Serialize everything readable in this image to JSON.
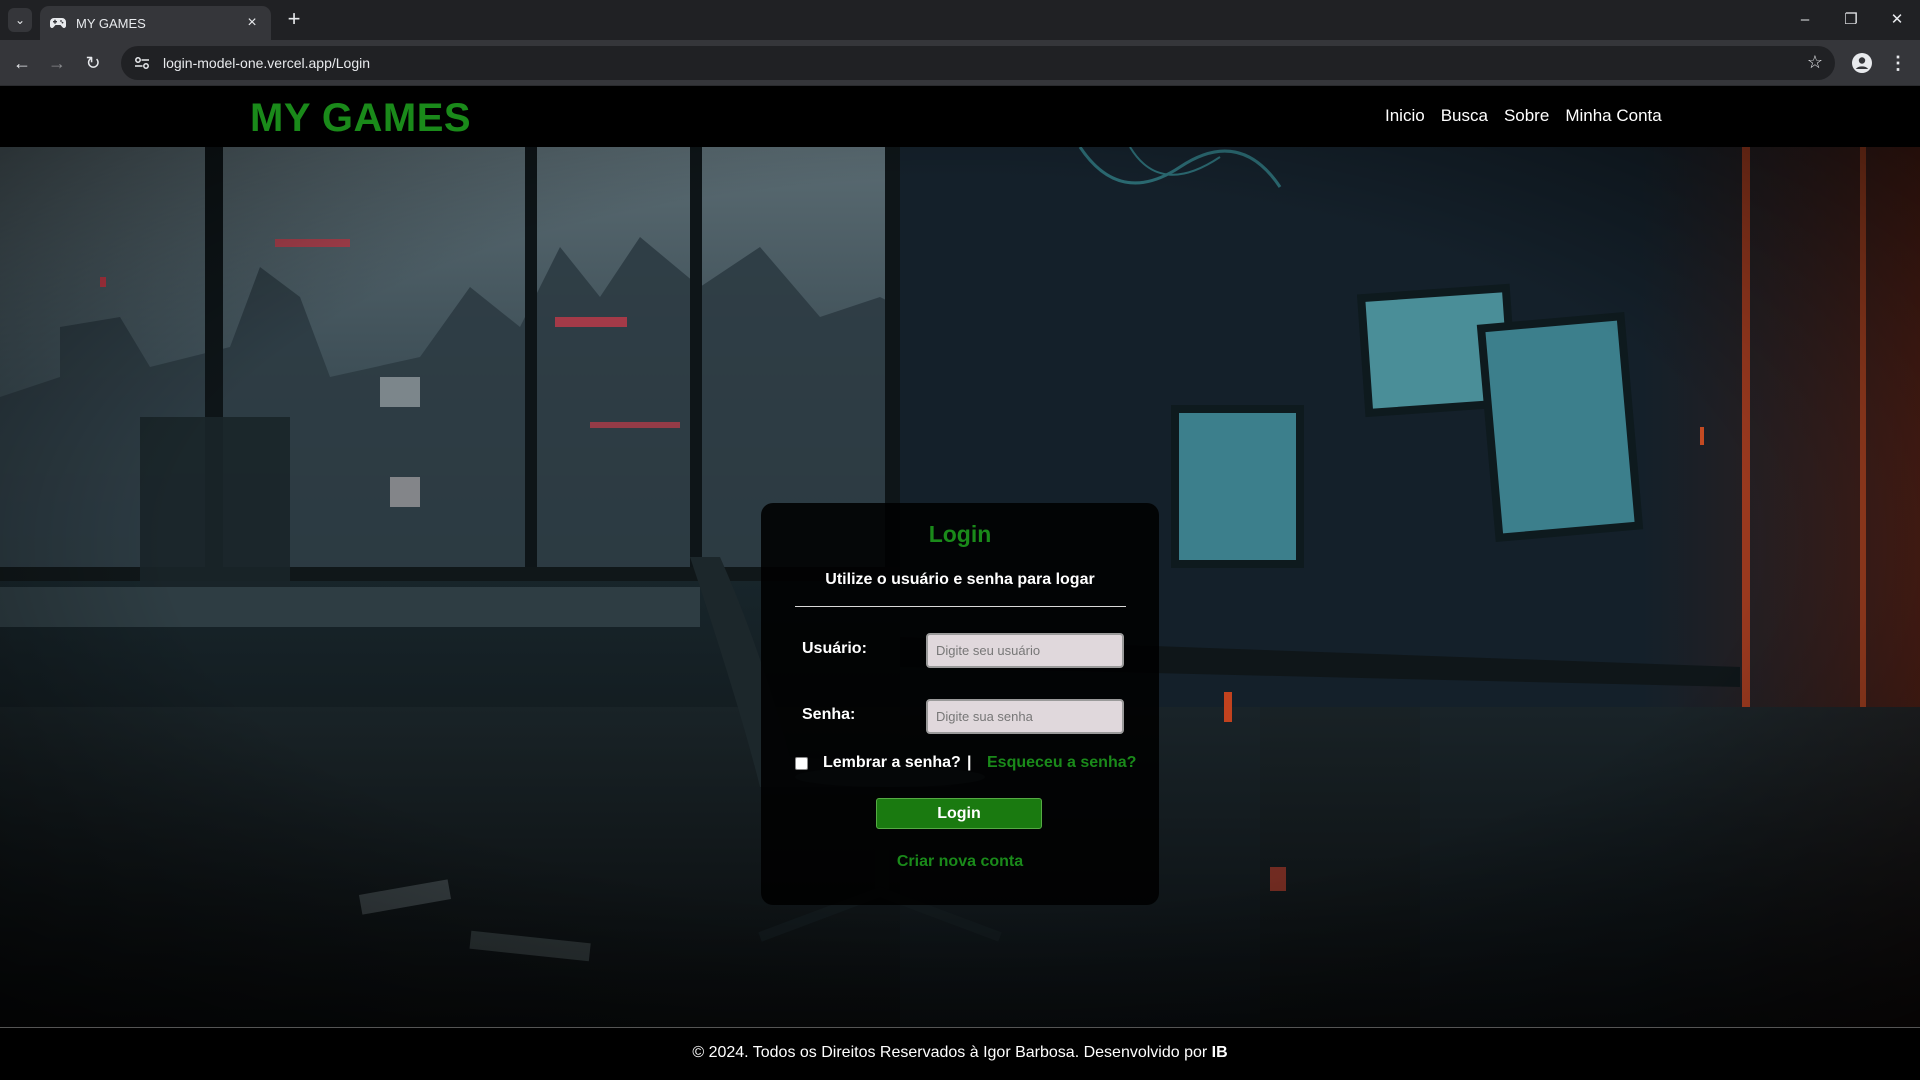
{
  "browser": {
    "tab_title": "MY GAMES",
    "url": "login-model-one.vercel.app/Login",
    "icons": [
      "tab-list-icon",
      "gamepad-icon",
      "close-icon",
      "plus-icon",
      "back-icon",
      "forward-icon",
      "reload-icon",
      "site-info-icon",
      "star-icon",
      "profile-icon",
      "menu-icon",
      "minimize-icon",
      "restore-icon",
      "close-window-icon"
    ]
  },
  "header": {
    "logo": "MY GAMES",
    "nav": [
      "Inicio",
      "Busca",
      "Sobre",
      "Minha Conta"
    ]
  },
  "login": {
    "title": "Login",
    "subtitle": "Utilize o usuário e senha para logar",
    "username_label": "Usuário:",
    "username_placeholder": "Digite seu usuário",
    "password_label": "Senha:",
    "password_placeholder": "Digite sua senha",
    "remember_label": "Lembrar a senha?",
    "separator": "|",
    "forgot_link": "Esqueceu a senha?",
    "submit_label": "Login",
    "create_account": "Criar nova conta"
  },
  "footer": {
    "text": "© 2024. Todos os Direitos Reservados à Igor Barbosa. Desenvolvido por ",
    "author": "IB"
  },
  "colors": {
    "brand_green": "#1a8a1a",
    "button_green": "#1a7a10",
    "background": "#000000"
  }
}
